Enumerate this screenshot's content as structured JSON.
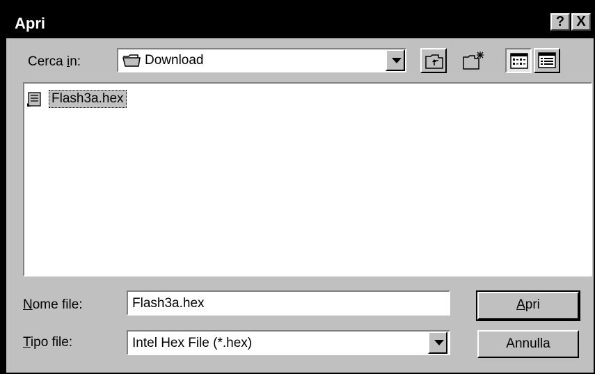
{
  "window": {
    "title": "Apri",
    "help_label": "?",
    "close_label": "X"
  },
  "lookin": {
    "label_prefix": "Cerca ",
    "label_accel": "i",
    "label_suffix": "n:",
    "value": "Download",
    "icon": "folder-icon"
  },
  "toolbar": {
    "up_icon": "up-folder-icon",
    "new_folder_icon": "new-folder-icon",
    "list_view_icon": "list-view-icon",
    "details_view_icon": "details-view-icon"
  },
  "files": [
    {
      "name": "Flash3a.hex",
      "icon": "hex-file-icon",
      "selected": true
    }
  ],
  "filename": {
    "label_accel": "N",
    "label_rest": "ome file:",
    "value": "Flash3a.hex"
  },
  "filetype": {
    "label_accel": "T",
    "label_rest": "ipo file:",
    "value": "Intel Hex File (*.hex)"
  },
  "buttons": {
    "open_accel": "A",
    "open_rest": "pri",
    "cancel": "Annulla"
  }
}
